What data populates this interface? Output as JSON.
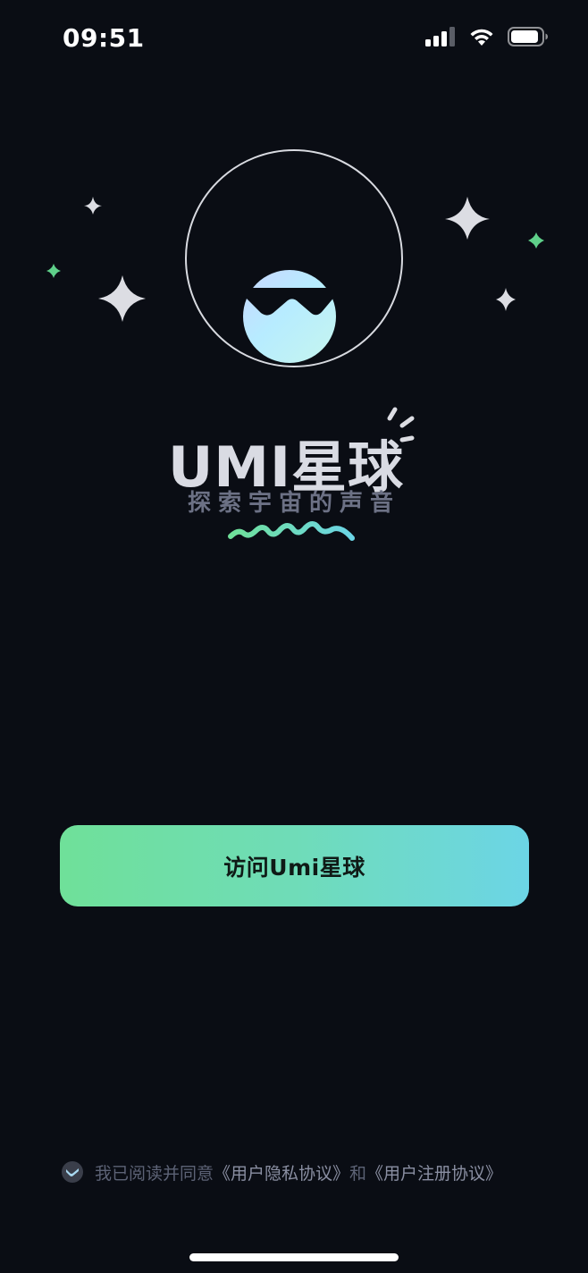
{
  "status_bar": {
    "time": "09:51",
    "icons": [
      "cellular-signal-icon",
      "wifi-icon",
      "battery-icon"
    ]
  },
  "hero": {
    "logo_icon": "planet-logo-icon",
    "sparkle_icon": "sparkle-icon",
    "accent_colors": [
      "#6fe099",
      "#6cd5e6",
      "#a8c6ff"
    ]
  },
  "branding": {
    "title": "UMI星球",
    "tagline": "探索宇宙的声音"
  },
  "cta": {
    "label": "访问Umi星球"
  },
  "agreement": {
    "prefix": "我已阅读并同意",
    "privacy_link": "《用户隐私协议》",
    "conjunction": "和",
    "register_link": "《用户注册协议》"
  },
  "colors": {
    "background": "#0a0d14",
    "button_gradient_start": "#6fe099",
    "button_gradient_end": "#6cd5e6"
  }
}
